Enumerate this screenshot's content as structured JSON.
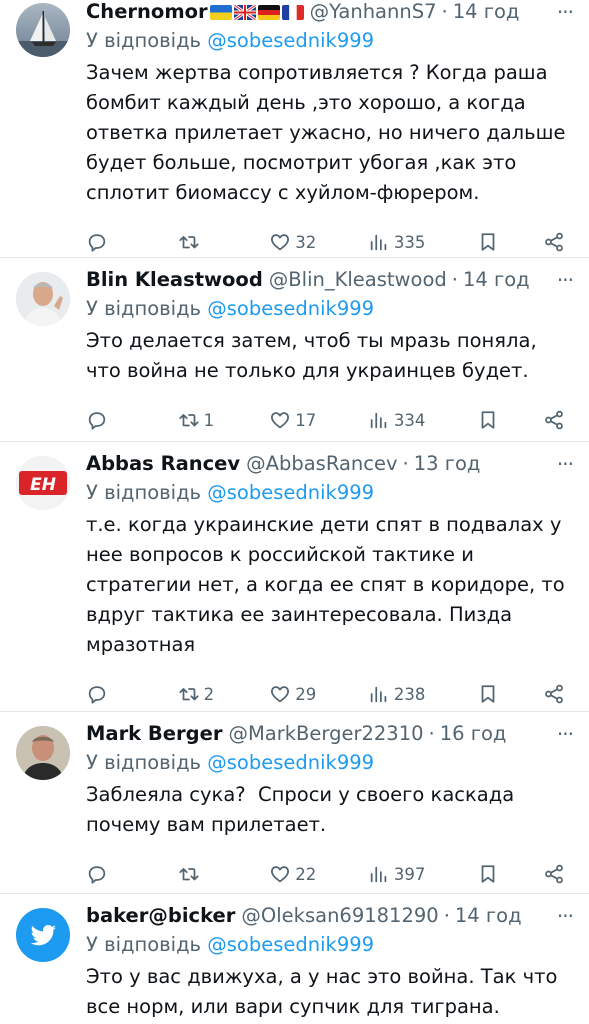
{
  "reply_prefix": "У відповідь",
  "tweets": [
    {
      "name": "Chernomor",
      "handle": "@YanhannS7",
      "time": "14 год",
      "mention": "@sobesednik999",
      "text": "Зачем жертва сопротивляется ? Когда раша бомбит каждый день ,это хорошо, а когда ответка прилетает ужасно, но ничего дальше будет больше, посмотрит убогая ,как это сплотит биомассу с хуйлом-фюрером.",
      "replies": "",
      "reposts": "",
      "likes": "32",
      "views": "335",
      "flags": [
        "ukraine",
        "uk",
        "germany",
        "france"
      ],
      "avatar_icon": "sailboat-icon"
    },
    {
      "name": "Blin Kleastwood",
      "handle": "@Blin_Kleastwood",
      "time": "14 год",
      "mention": "@sobesednik999",
      "text": "Это делается затем, чтоб ты мразь поняла, что война не только для украинцев будет.",
      "replies": "",
      "reposts": "1",
      "likes": "17",
      "views": "334",
      "avatar_icon": "person-photo-icon"
    },
    {
      "name": "Abbas Rancev",
      "handle": "@AbbasRancev",
      "time": "13 год",
      "mention": "@sobesednik999",
      "text": "т.е. когда украинские дети спят в подвалах у нее вопросов к российской тактике и стратегии нет, а когда ее спят в коридоре, то вдруг тактика ее заинтересовала. Пизда мразотная",
      "replies": "",
      "reposts": "2",
      "likes": "29",
      "views": "238",
      "avatar_text": "EH"
    },
    {
      "name": "Mark Berger",
      "handle": "@MarkBerger22310",
      "time": "16 год",
      "mention": "@sobesednik999",
      "text": "Заблеяла сука?  Спроси у своего каскада почему вам прилетает.",
      "replies": "",
      "reposts": "",
      "likes": "22",
      "views": "397",
      "avatar_icon": "person-photo-icon"
    },
    {
      "name": "baker@bicker",
      "handle": "@Oleksan69181290",
      "time": "14 год",
      "mention": "@sobesednik999",
      "text": "Это у вас движуха, а у нас это война. Так что все норм, или вари супчик для тиграна.",
      "avatar_icon": "twitter-bird-icon"
    }
  ],
  "colors": {
    "accent": "#1d9bf0",
    "muted": "#536471",
    "divider": "#e3e8ec"
  }
}
